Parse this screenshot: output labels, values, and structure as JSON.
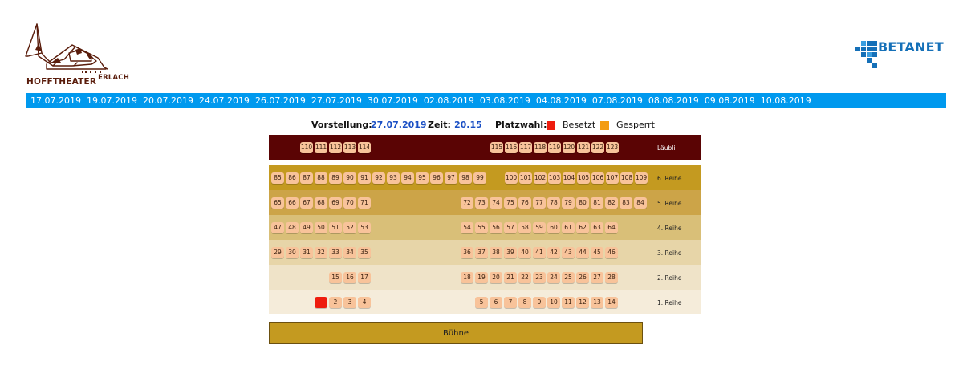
{
  "brand": {
    "name": "HOFFTHEATER",
    "name_suffix": "ERLACH",
    "partner_logo": "BETANET"
  },
  "dates": [
    "17.07.2019",
    "19.07.2019",
    "20.07.2019",
    "24.07.2019",
    "26.07.2019",
    "27.07.2019",
    "30.07.2019",
    "02.08.2019",
    "03.08.2019",
    "04.08.2019",
    "07.08.2019",
    "08.08.2019",
    "09.08.2019",
    "10.08.2019"
  ],
  "info": {
    "performance_label": "Vorstellung:",
    "performance_date": "27.07.2019",
    "time_label": "Zeit:",
    "time_value": "20.15",
    "seat_choice_label": "Platzwahl:",
    "legend_occupied": "Besetzt",
    "legend_blocked": "Gesperrt"
  },
  "colors": {
    "accent": "#0099ee",
    "occupied": "#ee1c0e",
    "blocked": "#f39c12",
    "seat": "#f8c39a",
    "laeubli_bg": "#5a0404",
    "stage": "#c49a20"
  },
  "rows": [
    {
      "label": "Läubli",
      "seats": [
        "110",
        "111",
        "112",
        "113",
        "114",
        "115",
        "116",
        "117",
        "118",
        "119",
        "120",
        "121",
        "122",
        "123"
      ]
    },
    {
      "label": "6. Reihe",
      "seats": [
        "85",
        "86",
        "87",
        "88",
        "89",
        "90",
        "91",
        "92",
        "93",
        "94",
        "95",
        "96",
        "97",
        "98",
        "99",
        "100",
        "101",
        "102",
        "103",
        "104",
        "105",
        "106",
        "107",
        "108",
        "109"
      ]
    },
    {
      "label": "5. Reihe",
      "seats": [
        "65",
        "66",
        "67",
        "68",
        "69",
        "70",
        "71",
        "72",
        "73",
        "74",
        "75",
        "76",
        "77",
        "78",
        "79",
        "80",
        "81",
        "82",
        "83",
        "84"
      ]
    },
    {
      "label": "4. Reihe",
      "seats": [
        "47",
        "48",
        "49",
        "50",
        "51",
        "52",
        "53",
        "54",
        "55",
        "56",
        "57",
        "58",
        "59",
        "60",
        "61",
        "62",
        "63",
        "64"
      ]
    },
    {
      "label": "3. Reihe",
      "seats": [
        "29",
        "30",
        "31",
        "32",
        "33",
        "34",
        "35",
        "36",
        "37",
        "38",
        "39",
        "40",
        "41",
        "42",
        "43",
        "44",
        "45",
        "46"
      ]
    },
    {
      "label": "2. Reihe",
      "seats": [
        "15",
        "16",
        "17",
        "18",
        "19",
        "20",
        "21",
        "22",
        "23",
        "24",
        "25",
        "26",
        "27",
        "28"
      ]
    },
    {
      "label": "1. Reihe",
      "seats": [
        "1",
        "2",
        "3",
        "4",
        "5",
        "6",
        "7",
        "8",
        "9",
        "10",
        "11",
        "12",
        "13",
        "14"
      ],
      "occupied": [
        "1"
      ]
    }
  ],
  "stage_label": "Bühne"
}
